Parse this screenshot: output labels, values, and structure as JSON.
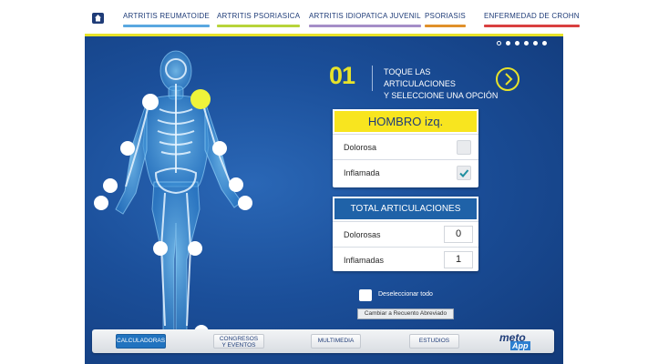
{
  "nav": {
    "tabs": [
      {
        "label": "ARTRITIS REUMATOIDE",
        "bar_color": "#5aa8e0"
      },
      {
        "label": "ARTRITIS PSORIASICA",
        "bar_color": "#b8d43a"
      },
      {
        "label": "ARTRITIS IDIOPATICA JUVENIL",
        "bar_color": "#a58ec8"
      },
      {
        "label": "PSORIASIS",
        "bar_color": "#e0902a"
      },
      {
        "label": "ENFERMEDAD DE CROHN",
        "bar_color": "#d94040"
      }
    ],
    "accent_color": "#e7e32a"
  },
  "pager": {
    "total": 6,
    "active_index": 0
  },
  "step": {
    "number": "01",
    "instruction_line1": "TOQUE LAS ARTICULACIONES",
    "instruction_line2": "Y SELECCIONE UNA OPCIÓN"
  },
  "joint_card": {
    "title": "HOMBRO izq.",
    "options": [
      {
        "label": "Dolorosa",
        "checked": false
      },
      {
        "label": "Inflamada",
        "checked": true
      }
    ]
  },
  "totals": {
    "title": "TOTAL ARTICULACIONES",
    "rows": [
      {
        "label": "Dolorosas",
        "value": "0"
      },
      {
        "label": "Inflamadas",
        "value": "1"
      }
    ]
  },
  "deselect_label": "Deseleccionar todo",
  "short_count_button": "Cambiar a Recuento Abreviado",
  "bottom_nav": {
    "calculators": "CALCULADORAS",
    "events_line1": "CONGRESOS",
    "events_line2": "Y EVENTOS",
    "multimedia": "MULTIMEDIA",
    "studies": "ESTUDIOS"
  },
  "brand": {
    "word1": "meto",
    "word2": "App"
  }
}
